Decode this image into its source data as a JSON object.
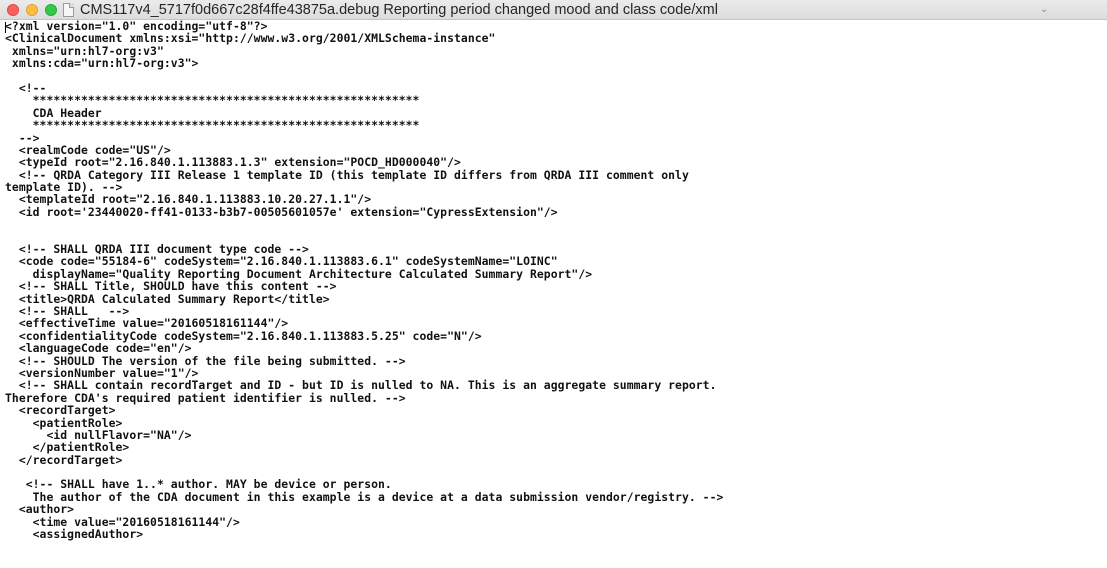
{
  "window": {
    "title": "CMS117v4_5717f0d667c28f4ffe43875a.debug Reporting period changed mood and  class code/xml",
    "chevron_icon": "chevron-down-icon",
    "doc_icon": "document-icon"
  },
  "editor": {
    "lines": [
      "<?xml version=\"1.0\" encoding=\"utf-8\"?>",
      "<ClinicalDocument xmlns:xsi=\"http://www.w3.org/2001/XMLSchema-instance\"",
      " xmlns=\"urn:hl7-org:v3\"",
      " xmlns:cda=\"urn:hl7-org:v3\">",
      "",
      "  <!--",
      "    ********************************************************",
      "    CDA Header",
      "    ********************************************************",
      "  -->",
      "  <realmCode code=\"US\"/>",
      "  <typeId root=\"2.16.840.1.113883.1.3\" extension=\"POCD_HD000040\"/>",
      "  <!-- QRDA Category III Release 1 template ID (this template ID differs from QRDA III comment only",
      "template ID). -->",
      "  <templateId root=\"2.16.840.1.113883.10.20.27.1.1\"/>",
      "  <id root='23440020-ff41-0133-b3b7-00505601057e' extension=\"CypressExtension\"/>",
      "",
      "",
      "  <!-- SHALL QRDA III document type code -->",
      "  <code code=\"55184-6\" codeSystem=\"2.16.840.1.113883.6.1\" codeSystemName=\"LOINC\"",
      "    displayName=\"Quality Reporting Document Architecture Calculated Summary Report\"/>",
      "  <!-- SHALL Title, SHOULD have this content -->",
      "  <title>QRDA Calculated Summary Report</title>",
      "  <!-- SHALL   -->",
      "  <effectiveTime value=\"20160518161144\"/>",
      "  <confidentialityCode codeSystem=\"2.16.840.1.113883.5.25\" code=\"N\"/>",
      "  <languageCode code=\"en\"/>",
      "  <!-- SHOULD The version of the file being submitted. -->",
      "  <versionNumber value=\"1\"/>",
      "  <!-- SHALL contain recordTarget and ID - but ID is nulled to NA. This is an aggregate summary report.",
      "Therefore CDA's required patient identifier is nulled. -->",
      "  <recordTarget>",
      "    <patientRole>",
      "      <id nullFlavor=\"NA\"/>",
      "    </patientRole>",
      "  </recordTarget>",
      "",
      "   <!-- SHALL have 1..* author. MAY be device or person.",
      "    The author of the CDA document in this example is a device at a data submission vendor/registry. -->",
      "  <author>",
      "    <time value=\"20160518161144\"/>",
      "    <assignedAuthor>"
    ]
  }
}
